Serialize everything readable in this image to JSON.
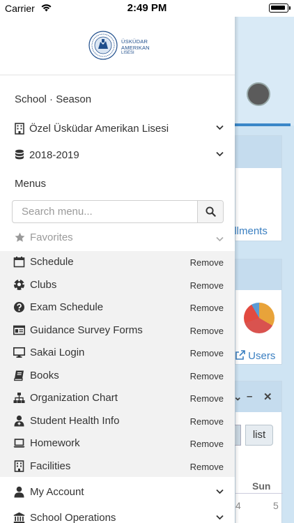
{
  "status_bar": {
    "carrier": "Carrier",
    "time": "2:49 PM"
  },
  "drawer": {
    "logo": {
      "line1": "ÜSKÜDAR",
      "line2": "AMERIKAN",
      "line3": "LISESI"
    },
    "school_season_title": "School · Season",
    "school_select": {
      "value": "Özel Üsküdar Amerikan Lisesi",
      "icon": "building-icon"
    },
    "season_select": {
      "value": "2018-2019",
      "icon": "database-icon"
    },
    "menus_title": "Menus",
    "search": {
      "placeholder": "Search menu...",
      "value": ""
    },
    "favorites": {
      "label": "Favorites",
      "icon": "star-icon"
    },
    "favorite_items": [
      {
        "label": "Schedule",
        "icon": "calendar-icon",
        "action": "Remove"
      },
      {
        "label": "Clubs",
        "icon": "soccer-ball-icon",
        "action": "Remove"
      },
      {
        "label": "Exam Schedule",
        "icon": "question-circle-icon",
        "action": "Remove"
      },
      {
        "label": "Guidance Survey Forms",
        "icon": "id-card-icon",
        "action": "Remove"
      },
      {
        "label": "Sakai Login",
        "icon": "desktop-icon",
        "action": "Remove"
      },
      {
        "label": "Books",
        "icon": "book-icon",
        "action": "Remove"
      },
      {
        "label": "Organization Chart",
        "icon": "sitemap-icon",
        "action": "Remove"
      },
      {
        "label": "Student Health Info",
        "icon": "user-md-icon",
        "action": "Remove"
      },
      {
        "label": "Homework",
        "icon": "laptop-icon",
        "action": "Remove"
      },
      {
        "label": "Facilities",
        "icon": "building-icon",
        "action": "Remove"
      }
    ],
    "menu_groups": [
      {
        "label": "My Account",
        "icon": "user-icon"
      },
      {
        "label": "School Operations",
        "icon": "institution-icon"
      }
    ]
  },
  "background_page": {
    "card1_link": "ollments",
    "card2_link": "Users",
    "card3_controls": [
      "⌄",
      "–",
      "✕"
    ],
    "calendar_buttons": [
      "n",
      "list"
    ],
    "calendar_day_header": "Sun",
    "calendar_numbers": [
      "4",
      "5"
    ]
  },
  "colors": {
    "accent": "#3a7fc1",
    "drawer_bg": "#ffffff",
    "favorites_bg": "#f2f2f2",
    "page_bg": "#cfe4f3"
  }
}
